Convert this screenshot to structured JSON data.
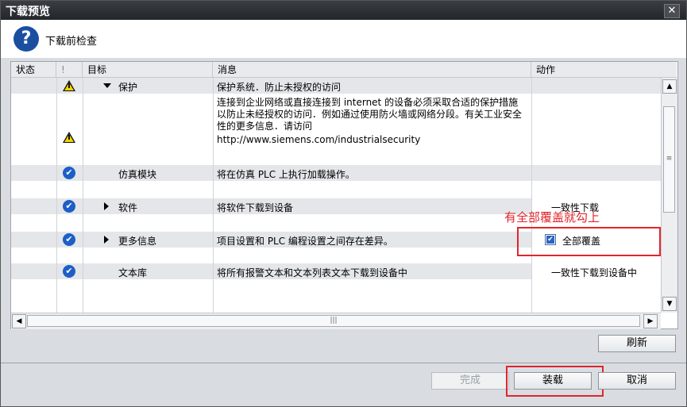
{
  "window": {
    "title": "下载预览",
    "close": "✕"
  },
  "header": {
    "icon": "question-icon",
    "icon_glyph": "?",
    "text": "下载前检查"
  },
  "columns": {
    "status": "状态",
    "flag": "!",
    "target": "目标",
    "message": "消息",
    "action": "动作"
  },
  "rows": [
    {
      "target": "保护",
      "message": "保护系统．防止未授权的访问",
      "icon": "warning-icon",
      "expand": "expanded"
    },
    {
      "message": "连接到企业网络或直接连接到 internet 的设备必须采取合适的保护措施以防止未经授权的访问．例如通过使用防火墙或网络分段。有关工业安全性的更多信息．请访问",
      "url": "http://www.siemens.com/industrialsecurity",
      "icon": "warning-icon"
    },
    {
      "target": "仿真模块",
      "message": "将在仿真 PLC 上执行加载操作。",
      "icon": "check-circle-icon"
    },
    {
      "target": "软件",
      "message": "将软件下载到设备",
      "action": "一致性下载",
      "icon": "check-circle-icon",
      "expand": "collapsed"
    },
    {
      "target": "更多信息",
      "message": "项目设置和 PLC 编程设置之间存在差异。",
      "action_checkbox": "全部覆盖",
      "checked": true,
      "icon": "check-circle-icon",
      "expand": "collapsed"
    },
    {
      "target": "文本库",
      "message": "将所有报警文本和文本列表文本下载到设备中",
      "action": "一致性下载到设备中",
      "icon": "check-circle-icon"
    }
  ],
  "annotation": "有全部覆盖就勾上",
  "buttons": {
    "refresh": "刷新",
    "finish": "完成",
    "load": "装载",
    "cancel": "取消"
  },
  "scroll": {
    "up": "▲",
    "down": "▼",
    "left": "◀",
    "right": "▶",
    "grip_v": "≡",
    "grip_h": "|||"
  },
  "colors": {
    "accent": "#1d5ec7",
    "highlight": "#e0262c",
    "warning": "#f5d300"
  }
}
